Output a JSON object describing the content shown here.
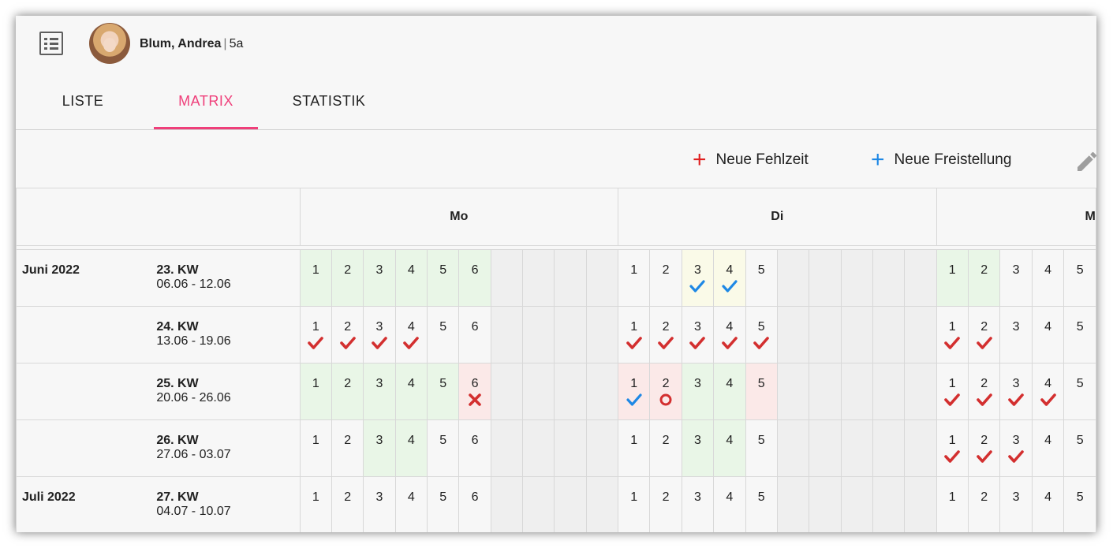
{
  "header": {
    "student_name": "Blum, Andrea",
    "separator": "|",
    "student_class": "5a",
    "icon": "list-icon"
  },
  "tabs": [
    {
      "label": "LISTE"
    },
    {
      "label": "MATRIX",
      "active": true
    },
    {
      "label": "STATISTIK"
    }
  ],
  "toolbar": {
    "new_absence_label": "Neue Fehlzeit",
    "new_absence_color": "#e02020",
    "new_release_label": "Neue Freistellung",
    "new_release_color": "#1e88e5",
    "edit_icon": "pencil-icon"
  },
  "colors": {
    "accent": "#ef3f7a",
    "present": "#e9f6e7",
    "pending": "#fafae8",
    "absent": "#fbe9e8",
    "check_red": "#d32f2f",
    "check_blue": "#1e88e5"
  },
  "days": [
    "Mo",
    "Di",
    "M"
  ],
  "rows": [
    {
      "month": "Juni 2022",
      "kw": "23. KW",
      "dates": "06.06 - 12.06",
      "days": [
        [
          {
            "n": "1",
            "bg": "green"
          },
          {
            "n": "2",
            "bg": "green"
          },
          {
            "n": "3",
            "bg": "green"
          },
          {
            "n": "4",
            "bg": "green"
          },
          {
            "n": "5",
            "bg": "green"
          },
          {
            "n": "6",
            "bg": "green"
          }
        ],
        [
          {
            "n": "1"
          },
          {
            "n": "2"
          },
          {
            "n": "3",
            "bg": "yellow",
            "mark": "check-blue"
          },
          {
            "n": "4",
            "bg": "yellow",
            "mark": "check-blue"
          },
          {
            "n": "5"
          }
        ],
        [
          {
            "n": "1",
            "bg": "green"
          },
          {
            "n": "2",
            "bg": "green"
          },
          {
            "n": "3"
          },
          {
            "n": "4"
          },
          {
            "n": "5"
          }
        ]
      ]
    },
    {
      "month": "",
      "kw": "24. KW",
      "dates": "13.06 - 19.06",
      "days": [
        [
          {
            "n": "1",
            "mark": "check-red"
          },
          {
            "n": "2",
            "mark": "check-red"
          },
          {
            "n": "3",
            "mark": "check-red"
          },
          {
            "n": "4",
            "mark": "check-red"
          },
          {
            "n": "5"
          },
          {
            "n": "6"
          }
        ],
        [
          {
            "n": "1",
            "mark": "check-red"
          },
          {
            "n": "2",
            "mark": "check-red"
          },
          {
            "n": "3",
            "mark": "check-red"
          },
          {
            "n": "4",
            "mark": "check-red"
          },
          {
            "n": "5",
            "mark": "check-red"
          }
        ],
        [
          {
            "n": "1",
            "mark": "check-red"
          },
          {
            "n": "2",
            "mark": "check-red"
          },
          {
            "n": "3"
          },
          {
            "n": "4"
          },
          {
            "n": "5"
          }
        ]
      ]
    },
    {
      "month": "",
      "kw": "25. KW",
      "dates": "20.06 - 26.06",
      "days": [
        [
          {
            "n": "1",
            "bg": "green"
          },
          {
            "n": "2",
            "bg": "green"
          },
          {
            "n": "3",
            "bg": "green"
          },
          {
            "n": "4",
            "bg": "green"
          },
          {
            "n": "5",
            "bg": "green"
          },
          {
            "n": "6",
            "bg": "red",
            "mark": "cross-red"
          }
        ],
        [
          {
            "n": "1",
            "bg": "red",
            "mark": "check-blue"
          },
          {
            "n": "2",
            "bg": "red",
            "mark": "circle-red"
          },
          {
            "n": "3",
            "bg": "green"
          },
          {
            "n": "4",
            "bg": "green"
          },
          {
            "n": "5",
            "bg": "red"
          }
        ],
        [
          {
            "n": "1",
            "mark": "check-red"
          },
          {
            "n": "2",
            "mark": "check-red"
          },
          {
            "n": "3",
            "mark": "check-red"
          },
          {
            "n": "4",
            "mark": "check-red"
          },
          {
            "n": "5"
          }
        ]
      ]
    },
    {
      "month": "",
      "kw": "26. KW",
      "dates": "27.06 - 03.07",
      "days": [
        [
          {
            "n": "1"
          },
          {
            "n": "2"
          },
          {
            "n": "3",
            "bg": "green"
          },
          {
            "n": "4",
            "bg": "green"
          },
          {
            "n": "5"
          },
          {
            "n": "6"
          }
        ],
        [
          {
            "n": "1"
          },
          {
            "n": "2"
          },
          {
            "n": "3",
            "bg": "green"
          },
          {
            "n": "4",
            "bg": "green"
          },
          {
            "n": "5"
          }
        ],
        [
          {
            "n": "1",
            "mark": "check-red"
          },
          {
            "n": "2",
            "mark": "check-red"
          },
          {
            "n": "3",
            "mark": "check-red"
          },
          {
            "n": "4"
          },
          {
            "n": "5"
          }
        ]
      ]
    },
    {
      "month": "Juli 2022",
      "kw": "27. KW",
      "dates": "04.07 - 10.07",
      "days": [
        [
          {
            "n": "1"
          },
          {
            "n": "2"
          },
          {
            "n": "3"
          },
          {
            "n": "4"
          },
          {
            "n": "5"
          },
          {
            "n": "6"
          }
        ],
        [
          {
            "n": "1"
          },
          {
            "n": "2"
          },
          {
            "n": "3"
          },
          {
            "n": "4"
          },
          {
            "n": "5"
          }
        ],
        [
          {
            "n": "1"
          },
          {
            "n": "2"
          },
          {
            "n": "3"
          },
          {
            "n": "4"
          },
          {
            "n": "5"
          }
        ]
      ]
    }
  ]
}
